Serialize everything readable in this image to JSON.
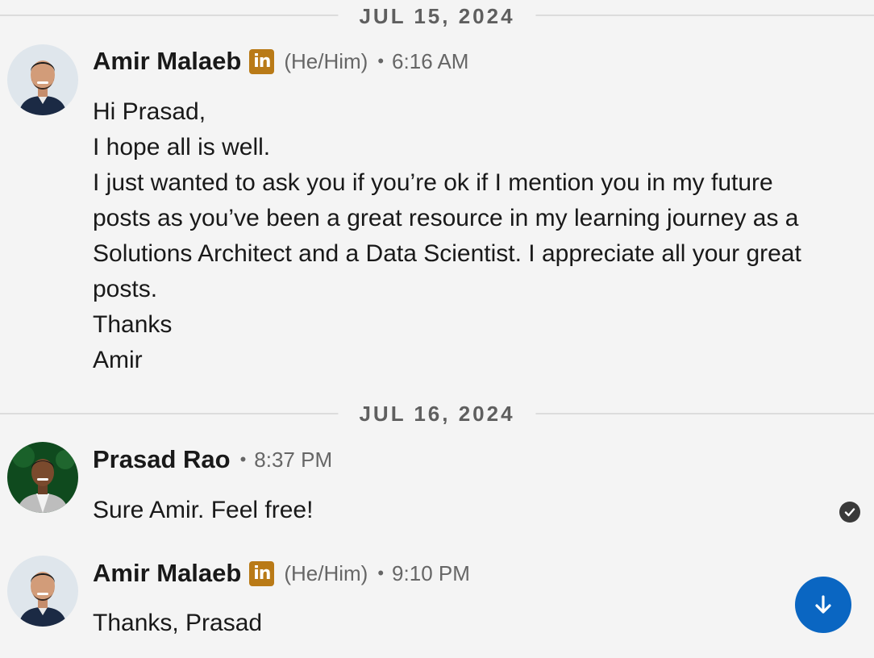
{
  "dates": {
    "first": "JUL 15, 2024",
    "second": "JUL 16, 2024"
  },
  "messages": [
    {
      "sender": "Amir Malaeb",
      "badge": "in",
      "pronouns": "(He/Him)",
      "separator": "•",
      "time": "6:16 AM",
      "lines": [
        "Hi Prasad,",
        "I hope all is well.",
        "I just wanted to ask you if you’re ok if I mention you in my future posts as you’ve been a great resource in my learning journey as a Solutions Architect and a Data Scientist. I appreciate all your great posts.",
        "Thanks",
        "Amir"
      ]
    },
    {
      "sender": "Prasad Rao",
      "separator": "•",
      "time": "8:37 PM",
      "lines": [
        "Sure Amir. Feel free!"
      ]
    },
    {
      "sender": "Amir Malaeb",
      "badge": "in",
      "pronouns": "(He/Him)",
      "separator": "•",
      "time": "9:10 PM",
      "lines": [
        "Thanks, Prasad"
      ]
    }
  ],
  "icons": {
    "read_receipt": "check-circle-icon",
    "scroll": "arrow-down-icon",
    "badge": "linkedin-icon"
  },
  "colors": {
    "background": "#f4f4f4",
    "linkedin_badge": "#b97a17",
    "scroll_button": "#0a66c2",
    "date_text": "#5f5f5f"
  }
}
